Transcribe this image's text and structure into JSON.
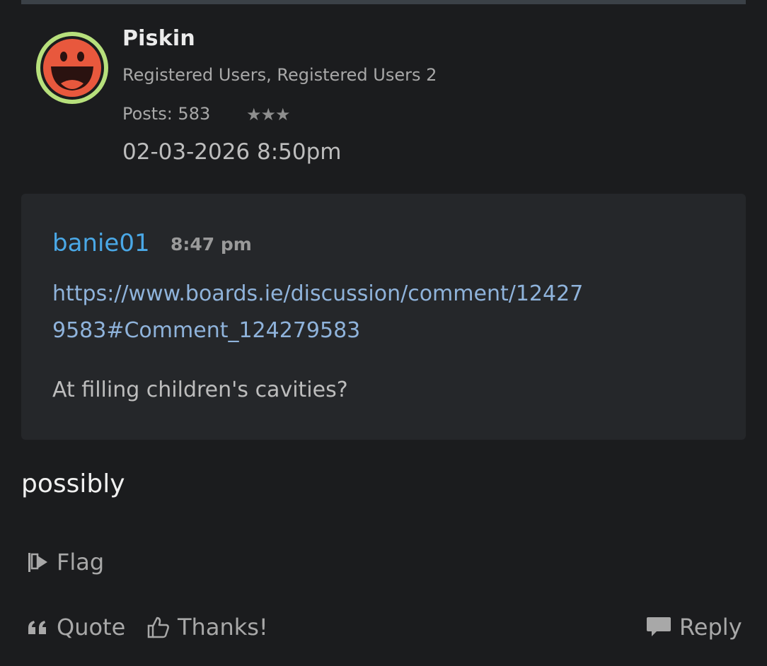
{
  "author": {
    "name": "Piskin",
    "roles": "Registered Users, Registered Users 2",
    "posts": "Posts: 583",
    "rank_stars": "★★★",
    "avatar_icon": "grinning-face-icon"
  },
  "post": {
    "date": "02-03-2026 8:50pm",
    "body": "possibly"
  },
  "quote": {
    "author": "banie01",
    "time": "8:47 pm",
    "link": "https://www.boards.ie/discussion/comment/124279583#Comment_124279583",
    "text": "At filling children's cavities?"
  },
  "actions": {
    "flag": "Flag",
    "quote": "Quote",
    "thanks": "Thanks!",
    "reply": "Reply"
  },
  "colors": {
    "background": "#1b1c1e",
    "quote_background": "#25272a",
    "link": "#8fb3db",
    "username_accent": "#4aa8e6",
    "avatar_ring": "#b7e07c",
    "avatar_face": "#e8583d"
  }
}
